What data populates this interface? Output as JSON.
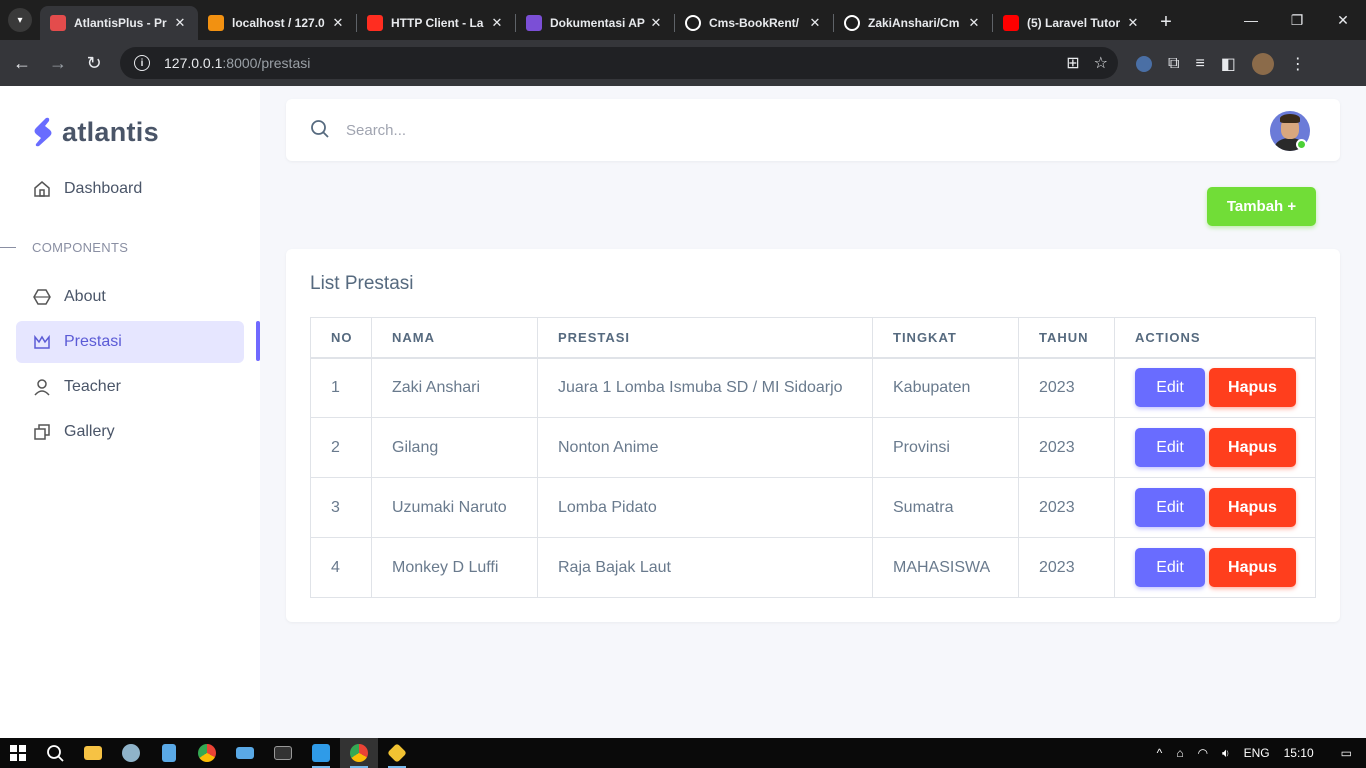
{
  "browser": {
    "tabs": [
      {
        "title": "AtlantisPlus - Pr",
        "icon": "atlantis-favicon",
        "color": "#e34c4c",
        "active": true
      },
      {
        "title": "localhost / 127.0",
        "icon": "phpmyadmin-favicon",
        "color": "#f29111",
        "active": false
      },
      {
        "title": "HTTP Client - La",
        "icon": "laravel-favicon",
        "color": "#ff2d20",
        "active": false
      },
      {
        "title": "Dokumentasi AP",
        "icon": "rc-favicon",
        "color": "#7b4fd6",
        "active": false
      },
      {
        "title": "Cms-BookRent/",
        "icon": "github-icon",
        "color": "#ffffff",
        "active": false
      },
      {
        "title": "ZakiAnshari/Cm",
        "icon": "github-icon",
        "color": "#ffffff",
        "active": false
      },
      {
        "title": "(5) Laravel Tutor",
        "icon": "youtube-icon",
        "color": "#ff0000",
        "active": false
      }
    ],
    "url_host": "127.0.0.1",
    "url_path": ":8000/prestasi"
  },
  "sidebar": {
    "brand": "atlantis",
    "section_label": "COMPONENTS",
    "items": [
      {
        "label": "Dashboard",
        "icon": "home-icon"
      },
      {
        "label": "About",
        "icon": "cube-icon"
      },
      {
        "label": "Prestasi",
        "icon": "crown-icon",
        "active": true
      },
      {
        "label": "Teacher",
        "icon": "user-icon"
      },
      {
        "label": "Gallery",
        "icon": "copy-icon"
      }
    ]
  },
  "search": {
    "placeholder": "Search..."
  },
  "actions": {
    "add_label": "Tambah +"
  },
  "table_card": {
    "title": "List Prestasi",
    "columns": [
      "NO",
      "NAMA",
      "PRESTASI",
      "TINGKAT",
      "TAHUN",
      "ACTIONS"
    ],
    "rows": [
      {
        "no": "1",
        "nama": "Zaki Anshari",
        "prestasi": "Juara 1 Lomba Ismuba SD / MI Sidoarjo",
        "tingkat": "Kabupaten",
        "tahun": "2023"
      },
      {
        "no": "2",
        "nama": "Gilang",
        "prestasi": "Nonton Anime",
        "tingkat": "Provinsi",
        "tahun": "2023"
      },
      {
        "no": "3",
        "nama": "Uzumaki Naruto",
        "prestasi": "Lomba Pidato",
        "tingkat": "Sumatra",
        "tahun": "2023"
      },
      {
        "no": "4",
        "nama": "Monkey D Luffi",
        "prestasi": "Raja Bajak Laut",
        "tingkat": "MAHASISWA",
        "tahun": "2023"
      }
    ],
    "edit_label": "Edit",
    "delete_label": "Hapus"
  },
  "taskbar": {
    "lang": "ENG",
    "time": "15:10"
  },
  "colors": {
    "primary": "#696cff",
    "success": "#71dd37",
    "danger": "#ff3e1d"
  }
}
